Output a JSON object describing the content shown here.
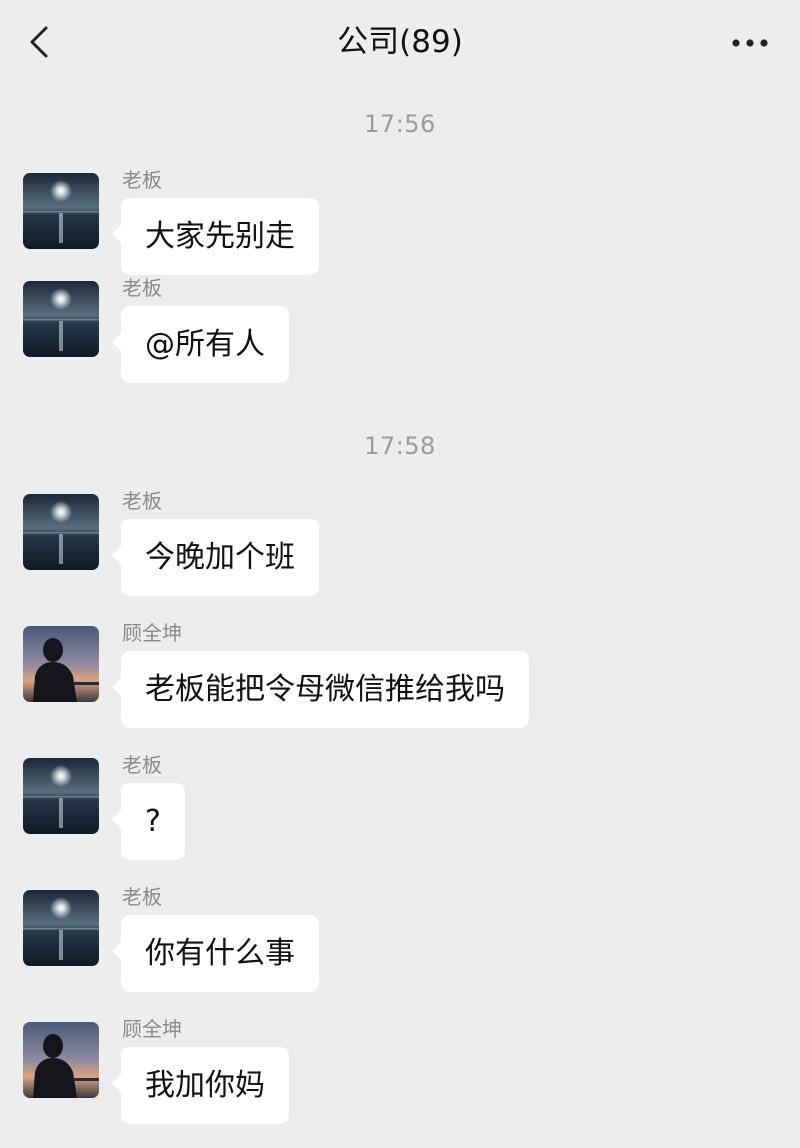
{
  "header": {
    "title": "公司(89)",
    "back_icon": "chevron-left-icon",
    "more_icon": "more-dots-icon"
  },
  "timestamps": [
    "17:56",
    "17:58"
  ],
  "messages": [
    {
      "sender": "老板",
      "text": "大家先别走",
      "avatar": "sea-moon-avatar"
    },
    {
      "sender": "老板",
      "text": "@所有人",
      "avatar": "sea-moon-avatar"
    },
    {
      "sender": "老板",
      "text": "今晚加个班",
      "avatar": "sea-moon-avatar"
    },
    {
      "sender": "顾全坤",
      "text": "老板能把令母微信推给我吗",
      "avatar": "silhouette-sunset-avatar"
    },
    {
      "sender": "老板",
      "text": "?",
      "avatar": "sea-moon-avatar"
    },
    {
      "sender": "老板",
      "text": "你有什么事",
      "avatar": "sea-moon-avatar"
    },
    {
      "sender": "顾全坤",
      "text": "我加你妈",
      "avatar": "silhouette-sunset-avatar"
    }
  ],
  "colors": {
    "background": "#ededed",
    "bubble": "#ffffff",
    "timestamp": "#9a9a9a",
    "sender": "#8a8a8a"
  }
}
